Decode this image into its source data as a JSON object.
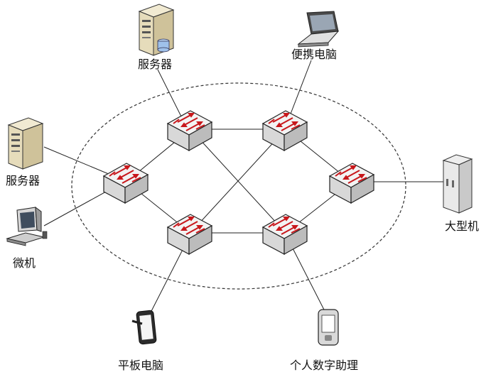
{
  "labels": {
    "server_top": "服务器",
    "laptop": "便携电脑",
    "server_left": "服务器",
    "pc": "微机",
    "mainframe": "大型机",
    "tablet": "平板电脑",
    "pda": "个人数字助理"
  },
  "colors": {
    "switch_face": "#dcdcdc",
    "switch_top": "#f4f4f4",
    "switch_arrow": "#cc1a1a",
    "line": "#222222",
    "ring": "#333333"
  },
  "icons": {
    "server": "server-icon",
    "laptop": "laptop-icon",
    "pc": "desktop-pc-icon",
    "mainframe": "mainframe-icon",
    "tablet": "tablet-icon",
    "pda": "pda-icon",
    "switch": "network-switch-icon"
  }
}
